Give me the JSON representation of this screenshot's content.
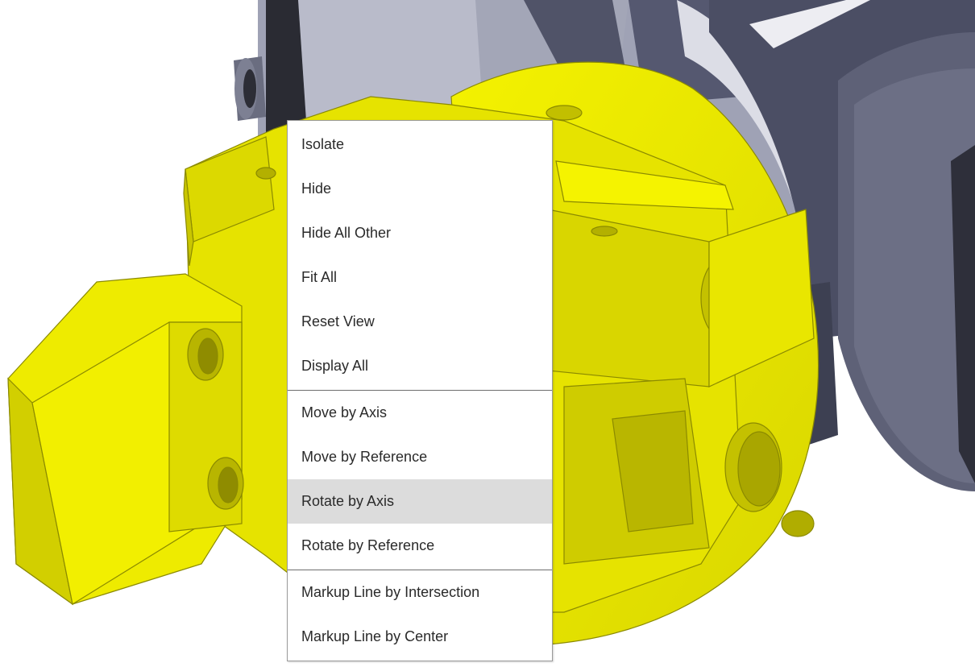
{
  "viewport": {
    "selection_color": "#f2f000",
    "model_color": "#4a4d62"
  },
  "context_menu": {
    "groups": [
      {
        "items": [
          {
            "label": "Isolate"
          },
          {
            "label": "Hide"
          },
          {
            "label": "Hide All Other"
          },
          {
            "label": "Fit All"
          },
          {
            "label": "Reset View"
          },
          {
            "label": "Display All"
          }
        ]
      },
      {
        "items": [
          {
            "label": "Move by Axis"
          },
          {
            "label": "Move by Reference"
          },
          {
            "label": "Rotate by Axis",
            "highlighted": true
          },
          {
            "label": "Rotate by Reference"
          }
        ]
      },
      {
        "items": [
          {
            "label": "Markup Line by Intersection"
          },
          {
            "label": "Markup Line by Center"
          }
        ]
      }
    ]
  }
}
